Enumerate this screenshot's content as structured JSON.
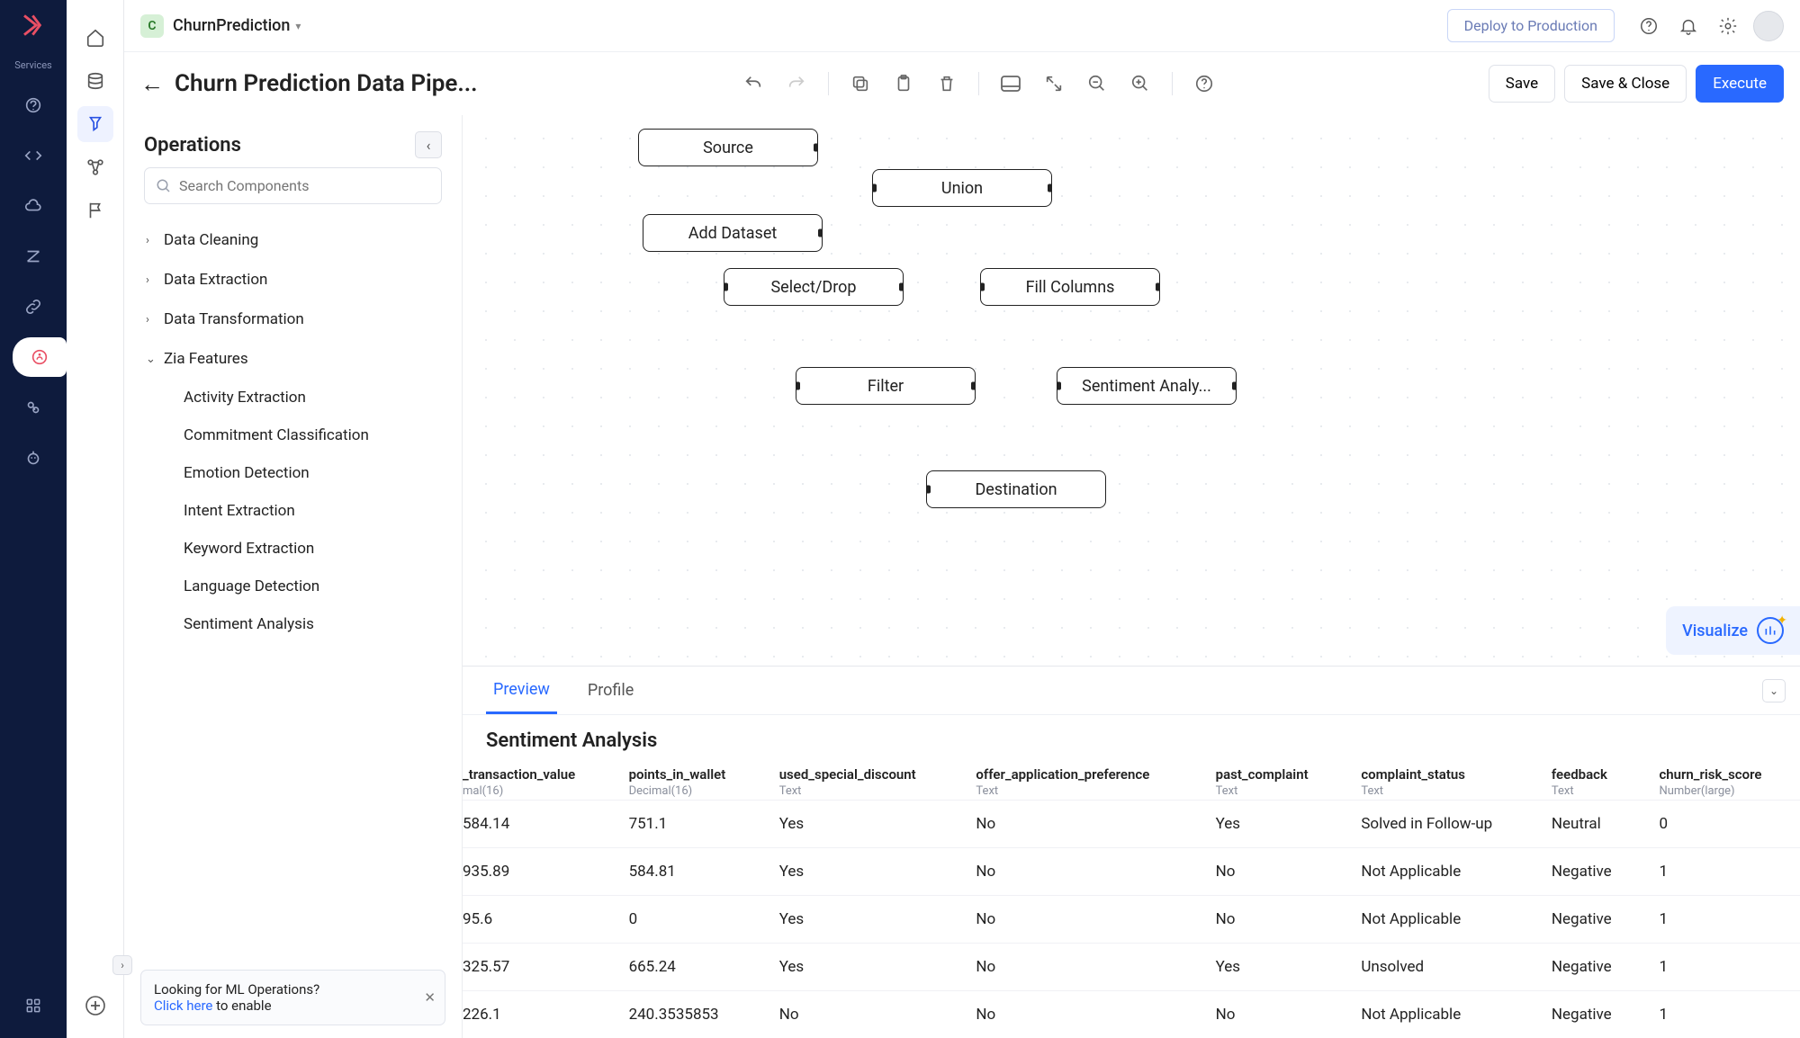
{
  "rail": {
    "services_label": "Services"
  },
  "topbar": {
    "workspace_badge": "C",
    "workspace_name": "ChurnPrediction",
    "deploy_label": "Deploy to Production"
  },
  "toolbar": {
    "page_title": "Churn Prediction Data Pipe...",
    "save_label": "Save",
    "save_close_label": "Save & Close",
    "execute_label": "Execute"
  },
  "ops": {
    "title": "Operations",
    "search_placeholder": "Search Components",
    "groups": [
      {
        "label": "Data Cleaning",
        "expanded": false
      },
      {
        "label": "Data Extraction",
        "expanded": false
      },
      {
        "label": "Data Transformation",
        "expanded": false
      },
      {
        "label": "Zia Features",
        "expanded": true,
        "items": [
          "Activity Extraction",
          "Commitment Classification",
          "Emotion Detection",
          "Intent Extraction",
          "Keyword Extraction",
          "Language Detection",
          "Sentiment Analysis"
        ]
      }
    ],
    "hint_text": "Looking for ML Operations?",
    "hint_link": "Click here",
    "hint_suffix": " to enable"
  },
  "canvas": {
    "nodes": {
      "source": "Source",
      "add_dataset": "Add Dataset",
      "union": "Union",
      "select_drop": "Select/Drop",
      "fill_columns": "Fill Columns",
      "filter": "Filter",
      "sentiment": "Sentiment Analy...",
      "destination": "Destination"
    },
    "visualize_label": "Visualize"
  },
  "preview": {
    "tabs": {
      "preview": "Preview",
      "profile": "Profile"
    },
    "section_title": "Sentiment Analysis",
    "columns": [
      {
        "name": "_transaction_value",
        "type": "mal(16)"
      },
      {
        "name": "points_in_wallet",
        "type": "Decimal(16)"
      },
      {
        "name": "used_special_discount",
        "type": "Text"
      },
      {
        "name": "offer_application_preference",
        "type": "Text"
      },
      {
        "name": "past_complaint",
        "type": "Text"
      },
      {
        "name": "complaint_status",
        "type": "Text"
      },
      {
        "name": "feedback",
        "type": "Text"
      },
      {
        "name": "churn_risk_score",
        "type": "Number(large)"
      }
    ],
    "rows": [
      [
        "584.14",
        "751.1",
        "Yes",
        "No",
        "Yes",
        "Solved in Follow-up",
        "Neutral",
        "0"
      ],
      [
        "935.89",
        "584.81",
        "Yes",
        "No",
        "No",
        "Not Applicable",
        "Negative",
        "1"
      ],
      [
        "95.6",
        "0",
        "Yes",
        "No",
        "No",
        "Not Applicable",
        "Negative",
        "1"
      ],
      [
        "325.57",
        "665.24",
        "Yes",
        "No",
        "Yes",
        "Unsolved",
        "Negative",
        "1"
      ],
      [
        "226.1",
        "240.3535853",
        "No",
        "No",
        "No",
        "Not Applicable",
        "Negative",
        "1"
      ]
    ]
  }
}
